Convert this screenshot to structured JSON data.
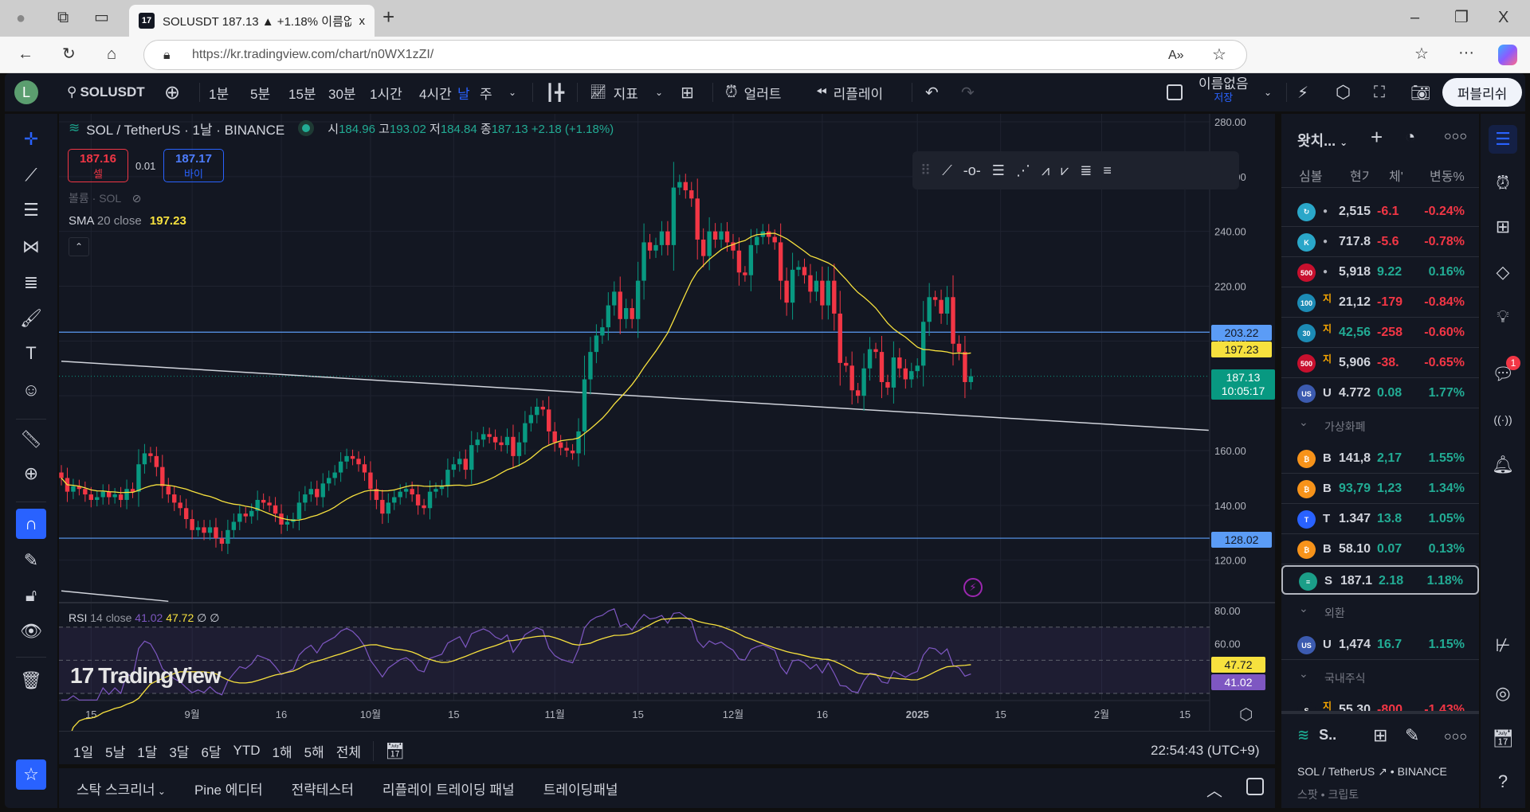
{
  "browser": {
    "tab_title": "SOLUSDT 187.13 ▲ +1.18% 이름없음",
    "tab_close": "x",
    "new_tab": "+",
    "url": "https://kr.tradingview.com/chart/n0WX1zZI/",
    "window_controls": [
      "–",
      "❐",
      "X"
    ]
  },
  "toolbar": {
    "avatar_letter": "L",
    "symbol": "SOLUSDT",
    "timeframes": [
      "1분",
      "5분",
      "15분",
      "30분",
      "1시간",
      "4시간",
      "날",
      "주"
    ],
    "active_timeframe": "날",
    "indicators_label": "지표",
    "alert_label": "얼러트",
    "replay_label": "리플레이",
    "layout_name": "이름없음",
    "save_label": "저장",
    "publish_label": "퍼블리쉬"
  },
  "legend": {
    "title": "SOL / TetherUS · 1날 · BINANCE",
    "o_label": "시",
    "o": "184.96",
    "h_label": "고",
    "h": "193.02",
    "l_label": "저",
    "l": "184.84",
    "c_label": "종",
    "c": "187.13",
    "change": "+2.18 (+1.18%)",
    "sell_price": "187.16",
    "sell_label": "셀",
    "spread": "0.01",
    "buy_price": "187.17",
    "buy_label": "바이",
    "volume_label": "볼륨 · SOL",
    "sma_label": "SMA",
    "sma_params": "20 close",
    "sma_value": "197.23",
    "rsi_label": "RSI",
    "rsi_params": "14 close",
    "rsi_value": "41.02",
    "rsi_ma_value": "47.72",
    "rsi_extra": "∅ ∅"
  },
  "chart_data": {
    "type": "candlestick",
    "interval": "1D",
    "date_range": [
      "2024-08-10",
      "2025-01-10"
    ],
    "close": [
      150,
      145,
      147,
      146,
      144,
      142,
      143,
      145,
      143,
      144,
      142,
      146,
      145,
      155,
      159,
      158,
      154,
      147,
      144,
      141,
      139,
      135,
      131,
      132,
      130,
      132,
      128,
      126,
      131,
      134,
      137,
      136,
      138,
      142,
      141,
      140,
      137,
      133,
      134,
      135,
      141,
      144,
      146,
      143,
      148,
      150,
      152,
      156,
      158,
      157,
      155,
      152,
      146,
      142,
      137,
      141,
      143,
      145,
      146,
      144,
      140,
      139,
      145,
      146,
      147,
      153,
      155,
      157,
      153,
      162,
      164,
      166,
      165,
      163,
      162,
      165,
      158,
      163,
      170,
      173,
      176,
      175,
      167,
      163,
      161,
      160,
      159,
      167,
      186,
      196,
      202,
      205,
      213,
      218,
      208,
      212,
      208,
      222,
      236,
      233,
      235,
      240,
      235,
      256,
      258,
      255,
      252,
      237,
      231,
      240,
      237,
      240,
      236,
      233,
      225,
      224,
      235,
      238,
      240,
      238,
      236,
      222,
      214,
      226,
      227,
      224,
      218,
      222,
      213,
      222,
      210,
      192,
      191,
      182,
      180,
      190,
      197,
      196,
      185,
      183,
      194,
      190,
      186,
      189,
      191,
      207,
      216,
      215,
      210,
      216,
      199,
      196,
      185,
      187.13
    ],
    "ylim": [
      104.8,
      282.9
    ],
    "price_ticks": [
      "280.00",
      "260.00",
      "240.00",
      "220.00",
      "200.00",
      "180.00",
      "160.00",
      "140.00",
      "120.00"
    ],
    "time_ticks": [
      {
        "date": "2024-08-15",
        "label": "15"
      },
      {
        "date": "2024-09-01",
        "label": "9월"
      },
      {
        "date": "2024-09-16",
        "label": "16"
      },
      {
        "date": "2024-10-01",
        "label": "10월"
      },
      {
        "date": "2024-10-15",
        "label": "15"
      },
      {
        "date": "2024-11-01",
        "label": "11월"
      },
      {
        "date": "2024-11-15",
        "label": "15"
      },
      {
        "date": "2024-12-01",
        "label": "12월"
      },
      {
        "date": "2024-12-16",
        "label": "16"
      },
      {
        "date": "2025-01-01",
        "label": "2025"
      },
      {
        "date": "2025-01-15",
        "label": "15"
      },
      {
        "date": "2025-02-01",
        "label": "2월"
      },
      {
        "date": "2025-02-15",
        "label": "15"
      }
    ],
    "rsi_ylim": [
      25,
      84
    ],
    "rsi_ticks": [
      "80.00",
      "60.00"
    ],
    "rsi_bands": [
      70,
      50,
      30
    ],
    "horizontal_lines": [
      {
        "price": 203.22,
        "label": "203.22",
        "color": "#5b9cf6"
      },
      {
        "price": 128.02,
        "label": "128.02",
        "color": "#5b9cf6"
      }
    ],
    "trend_lines": [
      {
        "from": [
          "2024-08-10",
          192.6
        ],
        "to": [
          "2025-02-19",
          167.4
        ],
        "color": "#d1d4dc"
      },
      {
        "from": [
          "2024-08-10",
          108.8
        ],
        "to": [
          "2024-08-28",
          105.0
        ],
        "color": "#d1d4dc"
      }
    ],
    "last_price_label": "187.13",
    "countdown": "10:05:17",
    "sma_axis_label": "197.23",
    "rsi_axis_labels": {
      "ma": "47.72",
      "rsi": "41.02"
    },
    "colors": {
      "up": "#089981",
      "down": "#f23645",
      "sma": "#f7e13e",
      "rsi": "#7e57c2",
      "rsi_ma": "#f7e13e",
      "bg": "#131722"
    }
  },
  "watermark": "TradingView",
  "range_bar": {
    "ranges": [
      "1일",
      "5날",
      "1달",
      "3달",
      "6달",
      "YTD",
      "1해",
      "5해",
      "전체"
    ],
    "clock": "22:54:43 (UTC+9)"
  },
  "bottom_tabs": [
    "스탁 스크리너",
    "Pine 에디터",
    "전략테스터",
    "리플레이 트레이딩 패널",
    "트레이딩패널"
  ],
  "watchlist": {
    "title": "왓치...",
    "columns": [
      "심볼",
      "현기",
      "체'",
      "변동%"
    ],
    "rows": [
      {
        "icon": "↻",
        "icon_bg": "#2aa7c9",
        "mark": "●",
        "price": "2,515",
        "price_color": "white",
        "chg": "-6.1",
        "pct": "-0.24%",
        "dir": "red"
      },
      {
        "icon": "K",
        "icon_bg": "#2aa7c9",
        "mark": "●",
        "price": "717.8",
        "price_color": "white",
        "chg": "-5.6",
        "pct": "-0.78%",
        "dir": "red"
      },
      {
        "icon": "500",
        "icon_bg": "#c8102e",
        "mark": "●",
        "price": "5,918",
        "price_color": "white",
        "chg": "9.22",
        "pct": "0.16%",
        "dir": "green"
      },
      {
        "icon": "100",
        "icon_bg": "#1c8bb5",
        "mark": "지",
        "price": "21,12",
        "price_color": "white",
        "chg": "-179",
        "pct": "-0.84%",
        "dir": "red"
      },
      {
        "icon": "30",
        "icon_bg": "#1c8bb5",
        "mark": "지",
        "price": "42,56",
        "price_color": "green",
        "chg": "-258",
        "pct": "-0.60%",
        "dir": "red"
      },
      {
        "icon": "500",
        "icon_bg": "#c8102e",
        "mark": "지",
        "price": "5,906",
        "price_color": "white",
        "chg": "-38.",
        "pct": "-0.65%",
        "dir": "red"
      },
      {
        "icon": "US",
        "icon_bg": "#3c5bb0",
        "mark": "U",
        "price": "4.772",
        "price_color": "white",
        "chg": "0.08",
        "pct": "1.77%",
        "dir": "green"
      }
    ],
    "group_crypto": "가상화폐",
    "crypto_rows": [
      {
        "icon": "₿",
        "icon_bg": "#f7931a",
        "mark": "B",
        "price": "141,8",
        "price_color": "white",
        "chg": "2,17",
        "pct": "1.55%",
        "dir": "green"
      },
      {
        "icon": "₿",
        "icon_bg": "#f7931a",
        "mark": "B",
        "price": "93,79",
        "price_color": "green",
        "chg": "1,23",
        "pct": "1.34%",
        "dir": "green"
      },
      {
        "icon": "T",
        "icon_bg": "#2962ff",
        "mark": "T",
        "price": "1.347",
        "price_color": "white",
        "chg": "13.8",
        "pct": "1.05%",
        "dir": "green"
      },
      {
        "icon": "₿",
        "icon_bg": "#f7931a",
        "mark": "B",
        "price": "58.10",
        "price_color": "white",
        "chg": "0.07",
        "pct": "0.13%",
        "dir": "green"
      },
      {
        "icon": "≡",
        "icon_bg": "#1b9e88",
        "mark": "S",
        "price": "187.1",
        "price_color": "white",
        "chg": "2.18",
        "pct": "1.18%",
        "dir": "green",
        "selected": true
      }
    ],
    "group_fx": "외환",
    "fx_rows": [
      {
        "icon": "US",
        "icon_bg": "#3c5bb0",
        "mark": "U",
        "price": "1,474",
        "price_color": "white",
        "chg": "16.7",
        "pct": "1.15%",
        "dir": "green"
      }
    ],
    "group_kr": "국내주식",
    "kr_rows": [
      {
        "icon": "S",
        "icon_bg": "#131722",
        "mark": "지",
        "price": "55,30",
        "price_color": "white",
        "chg": "-800",
        "pct": "-1.43%",
        "dir": "red"
      }
    ],
    "detail": {
      "short": "S..",
      "name": "SOL / TetherUS",
      "exchange": "• BINANCE",
      "type": "스팟 • 크립토"
    }
  },
  "notification_badge": "1"
}
